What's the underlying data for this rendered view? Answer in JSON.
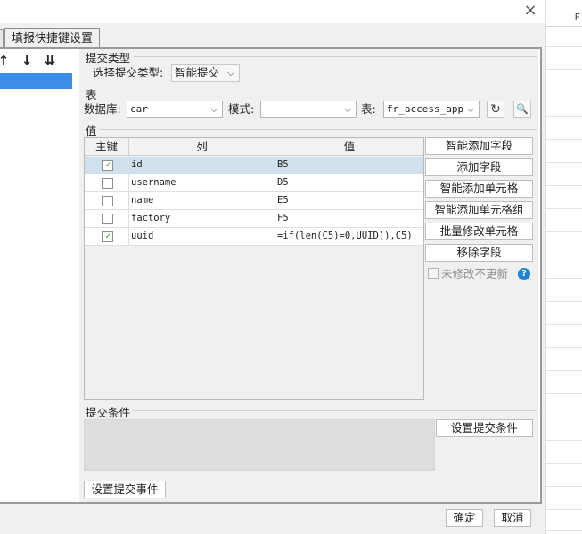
{
  "sheet": {
    "header_text": "F"
  },
  "dialog": {
    "close_glyph": "×"
  },
  "tab": {
    "label": "填报快捷键设置"
  },
  "left_toolbar": {
    "up": "↑",
    "down": "↓",
    "sort": "⇊"
  },
  "submit_type": {
    "group_label": "提交类型",
    "label": "选择提交类型:",
    "value": "智能提交"
  },
  "table_group": {
    "group_label": "表",
    "db_label": "数据库:",
    "db_value": "car",
    "mode_label": "模式:",
    "mode_value": "",
    "table_label": "表:",
    "table_value": "fr_access_app"
  },
  "values_group": {
    "group_label": "值",
    "columns": [
      "主键",
      "列",
      "值"
    ],
    "rows": [
      {
        "checked": true,
        "mark": "✓",
        "column": "id",
        "value": "B5"
      },
      {
        "checked": false,
        "mark": "",
        "column": "username",
        "value": "D5"
      },
      {
        "checked": false,
        "mark": "",
        "column": "name",
        "value": "E5"
      },
      {
        "checked": false,
        "mark": "",
        "column": "factory",
        "value": "F5"
      },
      {
        "checked": true,
        "mark": "✓",
        "column": "uuid",
        "value": "=if(len(C5)=0,UUID(),C5)"
      }
    ],
    "buttons": [
      "智能添加字段",
      "添加字段",
      "智能添加单元格",
      "智能添加单元格组",
      "批量修改单元格",
      "移除字段"
    ],
    "unchanged_label": "未修改不更新"
  },
  "condition_group": {
    "group_label": "提交条件",
    "set_button": "设置提交条件"
  },
  "event_button": "设置提交事件",
  "footer": {
    "ok": "确定",
    "cancel": "取消"
  },
  "colors": {
    "selection": "#3c8ee6",
    "row_selected": "#cfe0ef",
    "help": "#1e86d6"
  }
}
